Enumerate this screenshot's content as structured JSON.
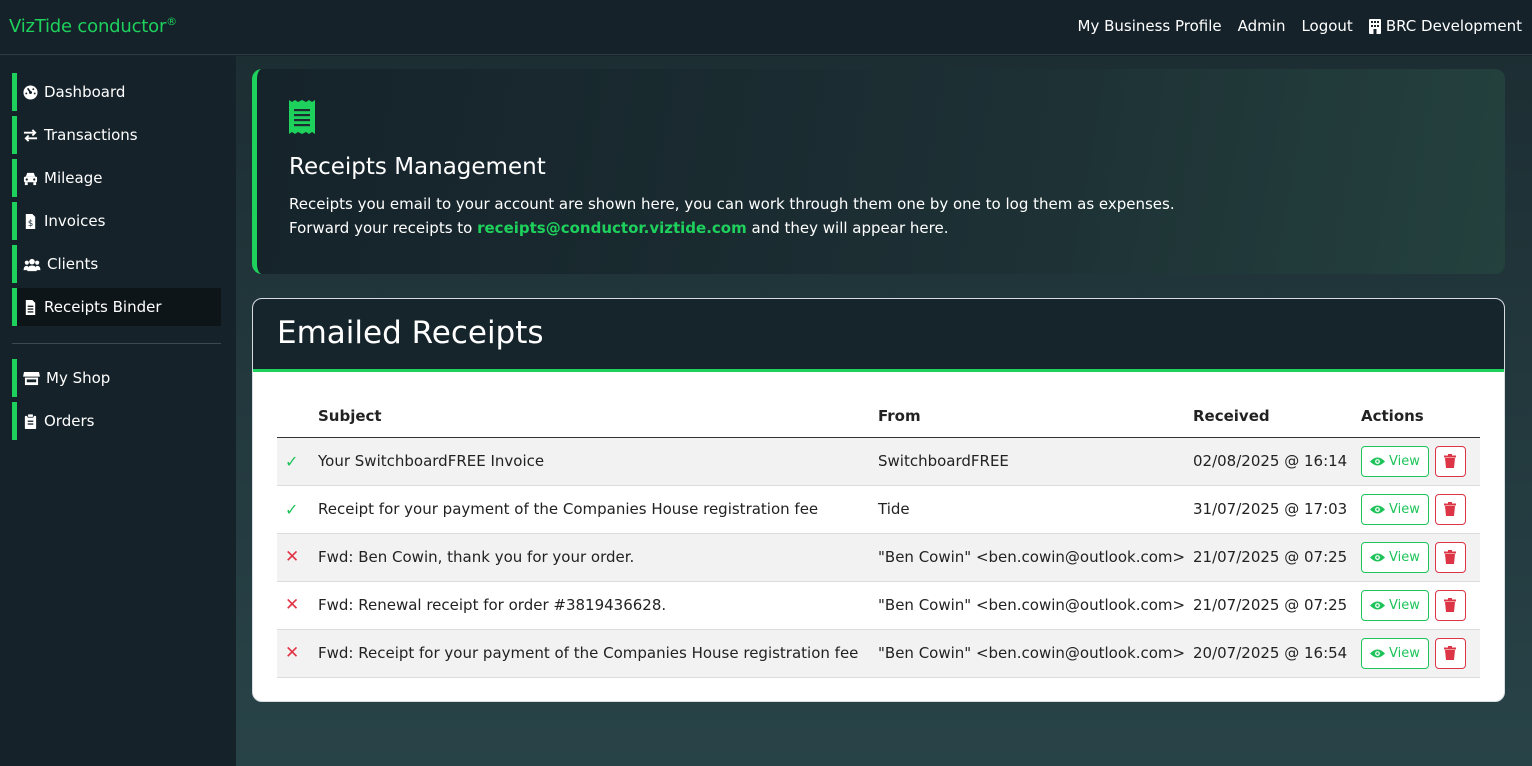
{
  "brand": {
    "name": "VizTide conductor",
    "mark": "®"
  },
  "topnav": {
    "business_profile": "My Business Profile",
    "admin": "Admin",
    "logout": "Logout",
    "company": "BRC Development"
  },
  "sidebar": {
    "items": [
      {
        "label": "Dashboard",
        "icon": "dashboard-icon"
      },
      {
        "label": "Transactions",
        "icon": "exchange-icon"
      },
      {
        "label": "Mileage",
        "icon": "car-icon"
      },
      {
        "label": "Invoices",
        "icon": "invoice-icon"
      },
      {
        "label": "Clients",
        "icon": "users-icon"
      },
      {
        "label": "Receipts Binder",
        "icon": "file-icon"
      },
      {
        "label": "My Shop",
        "icon": "store-icon"
      },
      {
        "label": "Orders",
        "icon": "clipboard-icon"
      }
    ]
  },
  "hero": {
    "title": "Receipts Management",
    "line1": "Receipts you email to your account are shown here, you can work through them one by one to log them as expenses.",
    "line2_prefix": "Forward your receipts to ",
    "email": "receipts@conductor.viztide.com",
    "line2_suffix": " and they will appear here."
  },
  "receipts": {
    "title": "Emailed Receipts",
    "columns": {
      "subject": "Subject",
      "from": "From",
      "received": "Received",
      "actions": "Actions"
    },
    "view_label": "View",
    "colors": {
      "accent": "#1ed15c",
      "danger": "#dc3545"
    },
    "rows": [
      {
        "status": "✓",
        "subject": "Your SwitchboardFREE Invoice",
        "from": "SwitchboardFREE",
        "received": "02/08/2025 @ 16:14"
      },
      {
        "status": "✓",
        "subject": "Receipt for your payment of the Companies House registration fee",
        "from": "Tide",
        "received": "31/07/2025 @ 17:03"
      },
      {
        "status": "✕",
        "subject": "Fwd: Ben Cowin, thank you for your order.",
        "from": "\"Ben Cowin\" <ben.cowin@outlook.com>",
        "received": "21/07/2025 @ 07:25"
      },
      {
        "status": "✕",
        "subject": "Fwd: Renewal receipt for order #3819436628.",
        "from": "\"Ben Cowin\" <ben.cowin@outlook.com>",
        "received": "21/07/2025 @ 07:25"
      },
      {
        "status": "✕",
        "subject": "Fwd: Receipt for your payment of the Companies House registration fee",
        "from": "\"Ben Cowin\" <ben.cowin@outlook.com>",
        "received": "20/07/2025 @ 16:54"
      }
    ]
  }
}
